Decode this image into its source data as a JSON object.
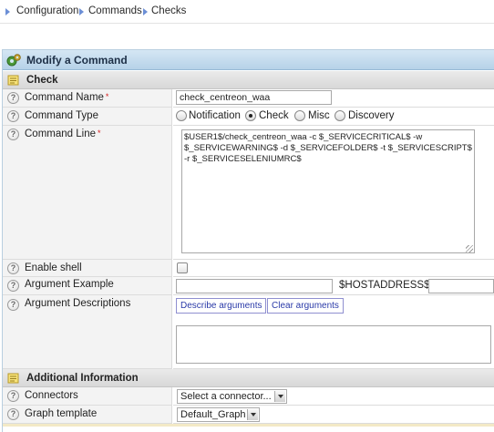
{
  "breadcrumb": [
    "Configuration",
    "Commands",
    "Checks"
  ],
  "form": {
    "title": "Modify a Command",
    "sections": {
      "check": "Check",
      "additional": "Additional Information"
    },
    "help_glyph": "?",
    "required_mark": "*",
    "labels": {
      "command_name": "Command Name",
      "command_type": "Command Type",
      "command_line": "Command Line",
      "enable_shell": "Enable shell",
      "argument_example": "Argument Example",
      "argument_descriptions": "Argument Descriptions",
      "connectors": "Connectors",
      "graph_template": "Graph template"
    },
    "command_name_value": "check_centreon_waa",
    "command_types": [
      "Notification",
      "Check",
      "Misc",
      "Discovery"
    ],
    "command_type_selected": "Check",
    "command_line_value": "$USER1$/check_centreon_waa -c $_SERVICECRITICAL$ -w $_SERVICEWARNING$ -d $_SERVICEFOLDER$ -t $_SERVICESCRIPT$ -r $_SERVICESELENIUMRC$",
    "enable_shell_checked": false,
    "argument_example_value": "",
    "hostaddress_label": "$HOSTADDRESS$",
    "hostaddress_value": "",
    "describe_arguments_label": "Describe arguments",
    "clear_arguments_label": "Clear arguments",
    "argument_descriptions_value": "",
    "connector_selected": "Select a connector...",
    "graph_template_selected": "Default_Graph"
  },
  "colors": {
    "header_gradient_top": "#d5e7f4",
    "header_gradient_bottom": "#b6d2e8",
    "breadcrumb_arrow": "#6c8fd6",
    "required_star": "#d62020",
    "link_button_text": "#2a3aa8"
  },
  "icons": {
    "header_icon": "command-gears-icon",
    "section_icon": "note-icon",
    "breadcrumb_separator": "triangle-right-icon",
    "help_icon": "question-mark-icon"
  }
}
